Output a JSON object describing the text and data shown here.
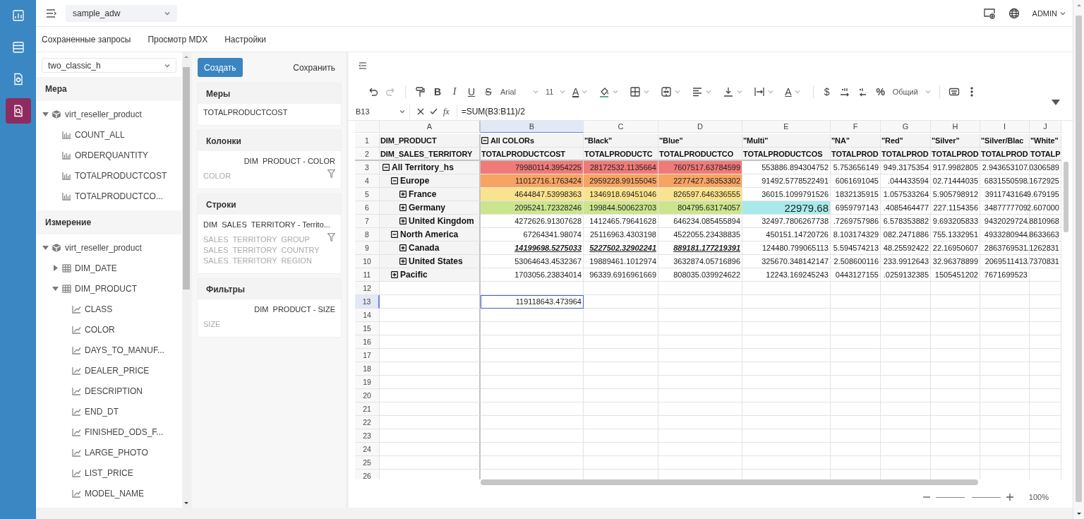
{
  "rail": [
    {
      "kind": "dashboard",
      "selected": false
    },
    {
      "kind": "table",
      "selected": false
    },
    {
      "kind": "report",
      "selected": false
    },
    {
      "kind": "query",
      "selected": true
    }
  ],
  "topbar": {
    "database": "sample_adw",
    "user": "ADMIN"
  },
  "tabs": [
    "Сохраненные запросы",
    "Просмотр MDX",
    "Настройки"
  ],
  "explorer": {
    "cube": "two_classic_h",
    "sections": [
      {
        "title": "Мера",
        "tree": [
          {
            "kind": "cube",
            "label": "virt_reseller_product",
            "expanded": true,
            "children": [
              {
                "kind": "measure",
                "label": "COUNT_ALL"
              },
              {
                "kind": "measure",
                "label": "ORDERQUANTITY"
              },
              {
                "kind": "measure",
                "label": "TOTALPRODUCTCOST"
              },
              {
                "kind": "measure",
                "label": "TOTALPRODUCTCO..."
              }
            ]
          }
        ]
      },
      {
        "title": "Измерение",
        "tree": [
          {
            "kind": "cube",
            "label": "virt_reseller_product",
            "expanded": true,
            "children": [
              {
                "kind": "table",
                "label": "DIM_DATE",
                "expanded": false
              },
              {
                "kind": "table",
                "label": "DIM_PRODUCT",
                "expanded": true,
                "children": [
                  {
                    "kind": "attribute",
                    "label": "CLASS"
                  },
                  {
                    "kind": "attribute",
                    "label": "COLOR"
                  },
                  {
                    "kind": "attribute",
                    "label": "DAYS_TO_MANUF..."
                  },
                  {
                    "kind": "attribute",
                    "label": "DEALER_PRICE"
                  },
                  {
                    "kind": "attribute",
                    "label": "DESCRIPTION"
                  },
                  {
                    "kind": "attribute",
                    "label": "END_DT"
                  },
                  {
                    "kind": "attribute",
                    "label": "FINISHED_ODS_F..."
                  },
                  {
                    "kind": "attribute",
                    "label": "LARGE_PHOTO"
                  },
                  {
                    "kind": "attribute",
                    "label": "LIST_PRICE"
                  },
                  {
                    "kind": "attribute",
                    "label": "MODEL_NAME"
                  }
                ]
              }
            ]
          }
        ]
      }
    ]
  },
  "query": {
    "create": "Создать",
    "save": "Сохранить",
    "zones": [
      {
        "kind": "measures",
        "title": "Меры",
        "items": [
          "TOTALPRODUCTCOST"
        ]
      },
      {
        "kind": "axis",
        "title": "Колонки",
        "dimension": "DIM  PRODUCT - COLOR",
        "levels": [
          "COLOR"
        ]
      },
      {
        "kind": "axis",
        "title": "Строки",
        "dimension": "DIM  SALES  TERRITORY - Territo...",
        "levels": [
          "SALES  TERRITORY  GROUP",
          "SALES  TERRITORY  COUNTRY",
          "SALES  TERRITORY  REGION"
        ]
      },
      {
        "kind": "filter",
        "title": "Фильтры",
        "dimension": "DIM  PRODUCT - SIZE",
        "levels": [
          "SIZE"
        ]
      }
    ]
  },
  "toolbar": [
    {
      "kind": "undo"
    },
    {
      "kind": "redo"
    },
    {
      "kind": "separator"
    },
    {
      "kind": "paint-format"
    },
    {
      "kind": "bold",
      "label": "B"
    },
    {
      "kind": "italic",
      "label": "I"
    },
    {
      "kind": "underline",
      "label": "U"
    },
    {
      "kind": "strike",
      "label": "S"
    },
    {
      "kind": "select",
      "value": "Arial"
    },
    {
      "kind": "select-small",
      "value": "11"
    },
    {
      "kind": "font-color",
      "label": "A"
    },
    {
      "kind": "fill"
    },
    {
      "kind": "borders"
    },
    {
      "kind": "merge"
    },
    {
      "kind": "align"
    },
    {
      "kind": "valign"
    },
    {
      "kind": "wrap"
    },
    {
      "kind": "rotate",
      "label": "A"
    },
    {
      "kind": "separator"
    },
    {
      "kind": "currency",
      "label": "$"
    },
    {
      "kind": "decimal-more"
    },
    {
      "kind": "decimal-less"
    },
    {
      "kind": "percent",
      "label": "%"
    },
    {
      "kind": "select",
      "value": "Общий"
    },
    {
      "kind": "separator"
    },
    {
      "kind": "comment"
    },
    {
      "kind": "more"
    }
  ],
  "formula_bar": {
    "cell": "B13",
    "function_label": "fx",
    "formula": "=SUM(B3:B11)/2"
  },
  "sheet": {
    "columns": [
      {
        "label": "A",
        "selected": false
      },
      {
        "label": "B",
        "selected": true
      },
      {
        "label": "C",
        "selected": false
      },
      {
        "label": "D",
        "selected": false
      },
      {
        "label": "E",
        "selected": false
      },
      {
        "label": "F",
        "selected": false
      },
      {
        "label": "G",
        "selected": false
      },
      {
        "label": "H",
        "selected": false
      },
      {
        "label": "I",
        "selected": false
      },
      {
        "label": "J",
        "selected": false
      }
    ],
    "header_rows": [
      {
        "number": "1",
        "selected": false,
        "cells": [
          {
            "kind": "header",
            "text": "DIM_PRODUCT"
          },
          {
            "kind": "member-header",
            "text": "All COLORs",
            "expanded": true
          },
          {
            "kind": "header",
            "text": "\"Black\""
          },
          {
            "kind": "header",
            "text": "\"Blue\""
          },
          {
            "kind": "header",
            "text": "\"Multi\""
          },
          {
            "kind": "header",
            "text": "\"NA\""
          },
          {
            "kind": "header",
            "text": "\"Red\""
          },
          {
            "kind": "header",
            "text": "\"Silver\""
          },
          {
            "kind": "header",
            "text": "\"Silver/Blac"
          },
          {
            "kind": "header",
            "text": "\"White\""
          }
        ]
      },
      {
        "number": "2",
        "selected": false,
        "cells": [
          {
            "kind": "header",
            "text": "DIM_SALES_TERRITORY"
          },
          {
            "kind": "header",
            "text": "TOTALPRODUCTCOST"
          },
          {
            "kind": "header",
            "text": "TOTALPRODUCTC"
          },
          {
            "kind": "header",
            "text": "TOTALPRODUCTCO"
          },
          {
            "kind": "header",
            "text": "TOTALPRODUCTCOS"
          },
          {
            "kind": "header",
            "text": "TOTALPROD"
          },
          {
            "kind": "header",
            "text": "TOTALPROD"
          },
          {
            "kind": "header",
            "text": "TOTALPROD"
          },
          {
            "kind": "header",
            "text": "TOTALPROD"
          },
          {
            "kind": "header",
            "text": "TOTALP"
          }
        ]
      }
    ],
    "pivot": [
      {
        "number": "3",
        "selected": false,
        "label": "All Territory_hs",
        "expanded": true,
        "cells": [
          {
            "kind": "number",
            "text": "79980114.3954225",
            "color": "#f07a78"
          },
          {
            "kind": "number",
            "text": "28172532.1135664",
            "color": "#f07a78"
          },
          {
            "kind": "number",
            "text": "7607517.63784599",
            "color": "#f07a78"
          },
          {
            "kind": "number",
            "text": "553886.894304752"
          },
          {
            "kind": "number",
            "text": "5.753656149"
          },
          {
            "kind": "number",
            "text": "949.3175354"
          },
          {
            "kind": "number",
            "text": "917.9982805"
          },
          {
            "kind": "number",
            "text": "2.943653107"
          },
          {
            "kind": "number",
            "text": ".0306589"
          }
        ],
        "children": [
          {
            "number": "4",
            "selected": false,
            "label": "Europe",
            "expanded": true,
            "cells": [
              {
                "kind": "number",
                "text": "11012716.1763424",
                "color": "#f7a462"
              },
              {
                "kind": "number",
                "text": "2959228.99155045",
                "color": "#f7a462"
              },
              {
                "kind": "number",
                "text": "2277427.36353302",
                "color": "#f7a462"
              },
              {
                "kind": "number",
                "text": "91492.5778522491"
              },
              {
                "kind": "number",
                "text": "6061691045"
              },
              {
                "kind": "number",
                "text": ".044433594"
              },
              {
                "kind": "number",
                "text": "02.71444035"
              },
              {
                "kind": "number",
                "text": "6831550598"
              },
              {
                "kind": "number",
                "text": ".1672925"
              }
            ],
            "children": [
              {
                "number": "5",
                "selected": false,
                "label": "France",
                "expanded": false,
                "cells": [
                  {
                    "kind": "number",
                    "text": "4644847.53998363",
                    "color": "#fae38e"
                  },
                  {
                    "kind": "number",
                    "text": "1346918.69451046",
                    "color": "#fae38e"
                  },
                  {
                    "kind": "number",
                    "text": "826597.646336555",
                    "color": "#fae38e"
                  },
                  {
                    "kind": "number",
                    "text": "36015.1099791526"
                  },
                  {
                    "kind": "number",
                    "text": "1832135915"
                  },
                  {
                    "kind": "number",
                    "text": "1.057533264"
                  },
                  {
                    "kind": "number",
                    "text": "5.905798912"
                  },
                  {
                    "kind": "number",
                    "text": "3911743164"
                  },
                  {
                    "kind": "number",
                    "text": "9.679195"
                  }
                ]
              },
              {
                "number": "6",
                "selected": false,
                "label": "Germany",
                "expanded": false,
                "cells": [
                  {
                    "kind": "number",
                    "text": "2095241.72328246",
                    "color": "#cbe58e"
                  },
                  {
                    "kind": "number",
                    "text": "199844.500623703",
                    "color": "#cbe58e"
                  },
                  {
                    "kind": "number",
                    "text": "804795.63174057",
                    "color": "#cbe58e"
                  },
                  {
                    "kind": "large",
                    "text": "22979.68",
                    "color": "#a8eaea"
                  },
                  {
                    "kind": "number",
                    "text": "6959797143"
                  },
                  {
                    "kind": "number",
                    "text": ".4085464477"
                  },
                  {
                    "kind": "number",
                    "text": "227.1154356"
                  },
                  {
                    "kind": "number",
                    "text": "3487777709"
                  },
                  {
                    "kind": "number",
                    "text": "2.607000"
                  }
                ]
              },
              {
                "number": "7",
                "selected": false,
                "label": "United Kingdom",
                "expanded": false,
                "cells": [
                  {
                    "kind": "number",
                    "text": "4272626.91307628"
                  },
                  {
                    "kind": "number",
                    "text": "1412465.79641628"
                  },
                  {
                    "kind": "number",
                    "text": "646234.085455894"
                  },
                  {
                    "kind": "number",
                    "text": "32497.7806267738"
                  },
                  {
                    "kind": "number",
                    "text": ".7269757986"
                  },
                  {
                    "kind": "number",
                    "text": "6.578353882"
                  },
                  {
                    "kind": "number",
                    "text": "9.693205833"
                  },
                  {
                    "kind": "number",
                    "text": "9432029724"
                  },
                  {
                    "kind": "number",
                    "text": ".8810968"
                  }
                ]
              }
            ]
          },
          {
            "number": "8",
            "selected": false,
            "label": "North America",
            "expanded": true,
            "cells": [
              {
                "kind": "number",
                "text": "67264341.98074"
              },
              {
                "kind": "number",
                "text": "25116963.4303198"
              },
              {
                "kind": "number",
                "text": "4522055.23438835"
              },
              {
                "kind": "number",
                "text": "450151.14720726"
              },
              {
                "kind": "number",
                "text": "8.103174329"
              },
              {
                "kind": "number",
                "text": "082.2471886"
              },
              {
                "kind": "number",
                "text": "755.1332951"
              },
              {
                "kind": "number",
                "text": "4933280944"
              },
              {
                "kind": "number",
                "text": ".8633663"
              }
            ],
            "children": [
              {
                "number": "9",
                "selected": false,
                "label": "Canada",
                "expanded": false,
                "cells": [
                  {
                    "kind": "emphasis",
                    "text": "14199698.5275033"
                  },
                  {
                    "kind": "emphasis",
                    "text": "5227502.32902241"
                  },
                  {
                    "kind": "emphasis",
                    "text": "889181.177219391"
                  },
                  {
                    "kind": "number",
                    "text": "124480.799065113"
                  },
                  {
                    "kind": "number",
                    "text": "5.594574213"
                  },
                  {
                    "kind": "number",
                    "text": "48.25592422"
                  },
                  {
                    "kind": "number",
                    "text": "22.16950607"
                  },
                  {
                    "kind": "number",
                    "text": "2863769531"
                  },
                  {
                    "kind": "number",
                    "text": ".1262831"
                  }
                ]
              },
              {
                "number": "10",
                "selected": false,
                "label": "United States",
                "expanded": false,
                "cells": [
                  {
                    "kind": "number",
                    "text": "53064643.4532367"
                  },
                  {
                    "kind": "number",
                    "text": "19889461.1012974"
                  },
                  {
                    "kind": "number",
                    "text": "3632874.05716896"
                  },
                  {
                    "kind": "number",
                    "text": "325670.348142147"
                  },
                  {
                    "kind": "number",
                    "text": "2.508600116"
                  },
                  {
                    "kind": "number",
                    "text": "233.9912643"
                  },
                  {
                    "kind": "number",
                    "text": "32.96378899"
                  },
                  {
                    "kind": "number",
                    "text": "2069511413"
                  },
                  {
                    "kind": "number",
                    "text": ".7370831"
                  }
                ]
              }
            ]
          },
          {
            "number": "11",
            "selected": false,
            "label": "Pacific",
            "expanded": false,
            "cells": [
              {
                "kind": "number",
                "text": "1703056.23834014"
              },
              {
                "kind": "number",
                "text": "96339.6916961669"
              },
              {
                "kind": "number",
                "text": "808035.039924622"
              },
              {
                "kind": "number",
                "text": "12243.169245243"
              },
              {
                "kind": "number",
                "text": "0443127155"
              },
              {
                "kind": "number",
                "text": ".0259132385"
              },
              {
                "kind": "number",
                "text": "1505451202"
              },
              {
                "kind": "number",
                "text": "7671699523"
              },
              {
                "kind": "empty"
              }
            ]
          }
        ]
      }
    ],
    "rows": [
      {
        "number": "12",
        "selected": false
      },
      {
        "number": "13",
        "selected": true,
        "cells": [
          {
            "kind": "empty",
            "selected": false
          },
          {
            "kind": "number",
            "text": "119118643.473964",
            "selected": true
          }
        ]
      },
      {
        "number": "14",
        "selected": false
      },
      {
        "number": "15",
        "selected": false
      },
      {
        "number": "16",
        "selected": false
      },
      {
        "number": "17",
        "selected": false
      },
      {
        "number": "18",
        "selected": false
      },
      {
        "number": "19",
        "selected": false
      },
      {
        "number": "20",
        "selected": false
      },
      {
        "number": "21",
        "selected": false
      },
      {
        "number": "22",
        "selected": false
      },
      {
        "number": "23",
        "selected": false
      },
      {
        "number": "24",
        "selected": false
      },
      {
        "number": "25",
        "selected": false
      },
      {
        "number": "26",
        "selected": false
      }
    ]
  },
  "zoom": {
    "level": 0.5,
    "label": "100%"
  }
}
